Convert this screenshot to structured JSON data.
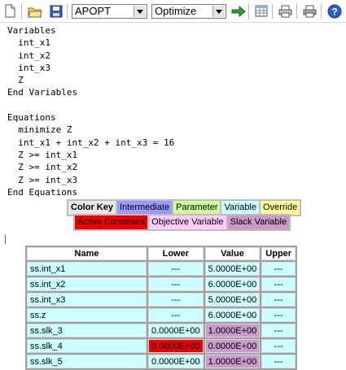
{
  "toolbar": {
    "solver_value": "APOPT",
    "mode_value": "Optimize"
  },
  "model_text": "Variables\n  int_x1\n  int_x2\n  int_x3\n  Z\nEnd Variables\n\nEquations\n  minimize Z\n  int_x1 + int_x2 + int_x3 = 16\n  Z >= int_x1\n  Z >= int_x2\n  Z >= int_x3\nEnd Equations",
  "color_key": {
    "title": "Color Key",
    "intermediate": "Intermediate",
    "parameter": "Parameter",
    "variable": "Variable",
    "override": "Override",
    "active_constraint": "Active Constraint",
    "objective_variable": "Objective Variable",
    "slack_variable": "Slack Variable"
  },
  "colors": {
    "title_bg": "#e6e6e6",
    "intermediate": "#9999ff",
    "parameter": "#ccff99",
    "variable": "#ccffff",
    "override": "#ffff99",
    "active_constraint": "#ee0000",
    "objective_variable": "#ffccff",
    "slack_variable": "#cc99cc",
    "default_cell": "#ffffff"
  },
  "results": {
    "headers": [
      "Name",
      "Lower",
      "Value",
      "Upper"
    ],
    "rows": [
      {
        "name": "ss.int_x1",
        "lower": "---",
        "value": "5.0000E+00",
        "upper": "---",
        "name_bg": "variable",
        "lower_bg": "variable",
        "value_bg": "variable",
        "upper_bg": "variable"
      },
      {
        "name": "ss.int_x2",
        "lower": "---",
        "value": "6.0000E+00",
        "upper": "---",
        "name_bg": "variable",
        "lower_bg": "variable",
        "value_bg": "variable",
        "upper_bg": "variable"
      },
      {
        "name": "ss.int_x3",
        "lower": "---",
        "value": "5.0000E+00",
        "upper": "---",
        "name_bg": "variable",
        "lower_bg": "variable",
        "value_bg": "variable",
        "upper_bg": "variable"
      },
      {
        "name": "ss.z",
        "lower": "---",
        "value": "6.0000E+00",
        "upper": "---",
        "name_bg": "variable",
        "lower_bg": "variable",
        "value_bg": "variable",
        "upper_bg": "variable"
      },
      {
        "name": "ss.slk_3",
        "lower": "0.0000E+00",
        "value": "1.0000E+00",
        "upper": "---",
        "name_bg": "variable",
        "lower_bg": "variable",
        "value_bg": "slack_variable",
        "upper_bg": "variable"
      },
      {
        "name": "ss.slk_4",
        "lower": "0.0000E+00",
        "value": "0.0000E+00",
        "upper": "---",
        "name_bg": "variable",
        "lower_bg": "active_constraint",
        "value_bg": "slack_variable",
        "upper_bg": "variable"
      },
      {
        "name": "ss.slk_5",
        "lower": "0.0000E+00",
        "value": "1.0000E+00",
        "upper": "---",
        "name_bg": "variable",
        "lower_bg": "variable",
        "value_bg": "slack_variable",
        "upper_bg": "variable"
      }
    ]
  }
}
